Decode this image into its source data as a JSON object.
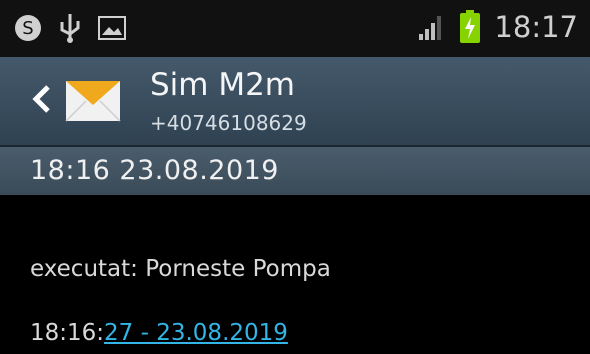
{
  "status_bar": {
    "left_icons": [
      "skype-icon",
      "usb-icon",
      "gallery-icon"
    ],
    "signal_icon": "signal-icon",
    "battery_icon": "battery-charging-icon",
    "time": "18:17"
  },
  "header": {
    "contact_name": "Sim M2m",
    "contact_number": "+40746108629"
  },
  "date_bar": {
    "text": "18:16  23.08.2019"
  },
  "messages": [
    {
      "text": "executat: Porneste Pompa"
    },
    {
      "prefix": "18:16:",
      "link": "27 - 23.08.2019"
    }
  ]
}
